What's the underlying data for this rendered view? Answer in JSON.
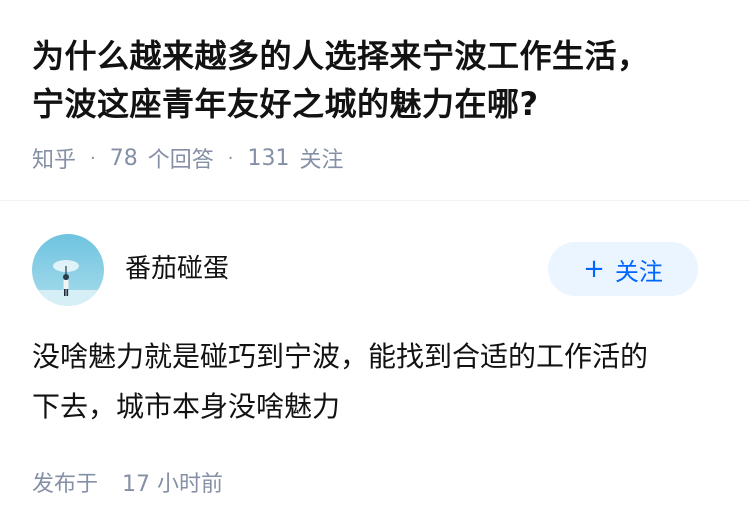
{
  "question": {
    "title_line1": "为什么越来越多的人选择来宁波工作生活，",
    "title_line2": "宁波这座青年友好之城的魅力在哪?",
    "source": "知乎",
    "answer_count": "78",
    "answer_label": "个回答",
    "follower_count": "131",
    "follower_label": "关注"
  },
  "answer": {
    "author_name": "番茄碰蛋",
    "follow_label": "关注",
    "follow_icon": "plus-icon",
    "content_line1": "没啥魅力就是碰巧到宁波，能找到合适的工作活的",
    "content_line2": "下去，城市本身没啥魅力",
    "published_label": "发布于",
    "published_time": "17 小时前"
  },
  "colors": {
    "accent": "#0066ff",
    "follow_bg": "#ebf5ff",
    "meta_text": "#8590a6",
    "main_text": "#121212"
  }
}
